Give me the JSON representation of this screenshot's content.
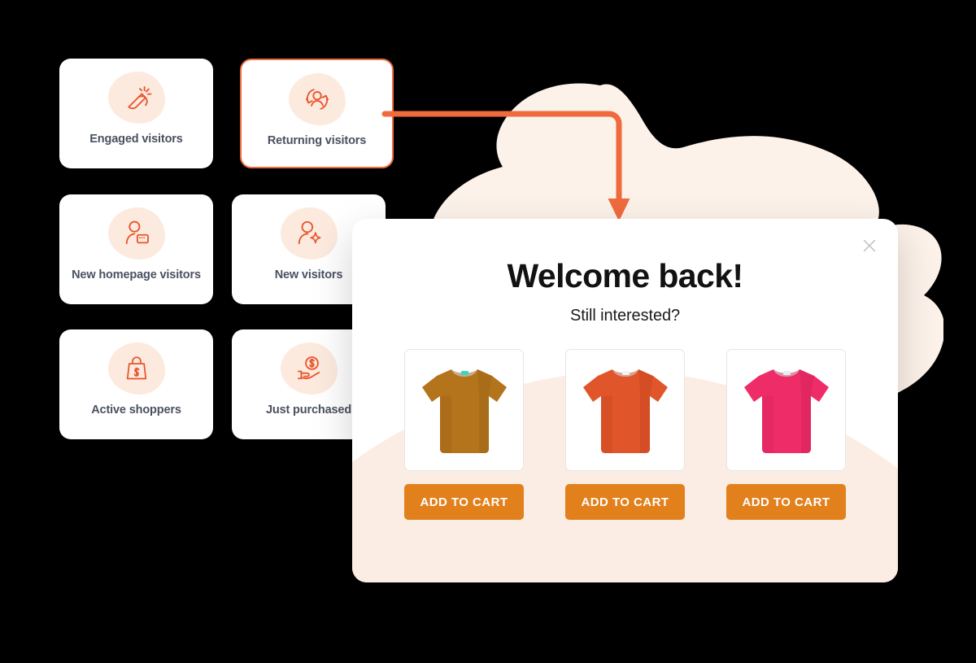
{
  "colors": {
    "accent_orange": "#EF6B3E",
    "icon_orange": "#E8552B",
    "icon_blob": "#FDEADF",
    "button_orange": "#E2801B",
    "cream_wave": "#FBEDE3",
    "background_blob": "#FDF2EA",
    "card_label": "#4A5160",
    "backdrop": "#000000"
  },
  "segments": {
    "cards": [
      {
        "id": "engaged",
        "label": "Engaged visitors",
        "icon": "magnet-icon",
        "selected": false
      },
      {
        "id": "returning",
        "label": "Returning visitors",
        "icon": "returning-user-icon",
        "selected": true
      },
      {
        "id": "newhome",
        "label": "New homepage visitors",
        "icon": "user-browser-icon",
        "selected": false
      },
      {
        "id": "newvisitors",
        "label": "New visitors",
        "icon": "user-sparkle-icon",
        "selected": false
      },
      {
        "id": "active",
        "label": "Active shoppers",
        "icon": "shopping-bag-dollar-icon",
        "selected": false
      },
      {
        "id": "justpurch",
        "label": "Just purchased",
        "icon": "hand-coin-icon",
        "selected": false
      }
    ]
  },
  "connector": {
    "name": "flow-arrow",
    "from_card": "returning",
    "to": "popup-modal"
  },
  "modal": {
    "title": "Welcome back!",
    "subtitle": "Still interested?",
    "close_label": "×",
    "close_icon": "close-icon",
    "products": [
      {
        "id": "product-1",
        "name": "T-shirt",
        "color_name": "ochre",
        "shirt_color": "#B4741C",
        "shirt_shade": "#91590F",
        "tag_color": "#3ED7B6",
        "button_label": "ADD TO CART"
      },
      {
        "id": "product-2",
        "name": "T-shirt",
        "color_name": "orange",
        "shirt_color": "#E1552A",
        "shirt_shade": "#BC3F18",
        "tag_color": "#F3F3F3",
        "button_label": "ADD TO CART"
      },
      {
        "id": "product-3",
        "name": "T-shirt",
        "color_name": "pink",
        "shirt_color": "#EE2D68",
        "shirt_shade": "#C81A50",
        "tag_color": "#E8EEF6",
        "button_label": "ADD TO CART"
      }
    ]
  }
}
